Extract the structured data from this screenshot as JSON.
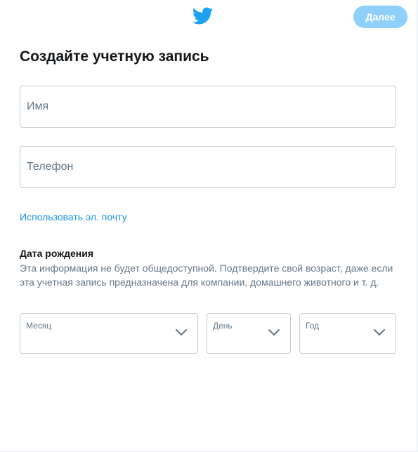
{
  "header": {
    "logo_icon": "twitter-bird-icon",
    "next_label": "Далее",
    "next_color": "#8ed0f9"
  },
  "title": "Создайте учетную запись",
  "fields": {
    "name": {
      "placeholder": "Имя",
      "value": ""
    },
    "phone": {
      "placeholder": "Телефон",
      "value": ""
    }
  },
  "use_email_link": "Использовать эл. почту",
  "dob": {
    "title": "Дата рождения",
    "description": "Эта информация не будет общедоступной. Подтвердите свой возраст, даже если эта учетная запись предназначена для компании, домашнего животного и т. д.",
    "month_label": "Месяц",
    "day_label": "День",
    "year_label": "Год",
    "chevron_icon": "chevron-down-icon"
  },
  "colors": {
    "brand_blue": "#1da1f2",
    "link_blue": "#1b95e0",
    "border": "#c4cfd6",
    "muted_text": "#657786"
  }
}
